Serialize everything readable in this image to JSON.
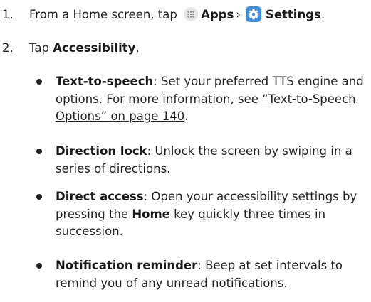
{
  "steps": [
    {
      "number": "1.",
      "prefix": "From a Home screen, tap",
      "apps_label": "Apps",
      "separator": "›",
      "settings_label": "Settings",
      "suffix": "."
    },
    {
      "number": "2.",
      "prefix": "Tap",
      "accessibility_label": "Accessibility",
      "suffix": "."
    }
  ],
  "bullets": [
    {
      "term": "Text-to-speech",
      "text": ": Set your preferred TTS engine and options. For more information, see ",
      "link": "“Text-to-Speech Options” on page 140",
      "after_link": "."
    },
    {
      "term": "Direction lock",
      "text": ": Unlock the screen by swiping in a series of directions."
    },
    {
      "term": "Direct access",
      "text_before": ": Open your accessibility settings by pressing the ",
      "key": "Home",
      "text_after": " key quickly three times in succession."
    },
    {
      "term": "Notification reminder",
      "text": ": Beep at set intervals to remind you of any unread notifications."
    }
  ],
  "icons": {
    "apps": "apps-grid-icon",
    "settings": "settings-gear-icon",
    "settings_color": "#3f8fd8"
  }
}
